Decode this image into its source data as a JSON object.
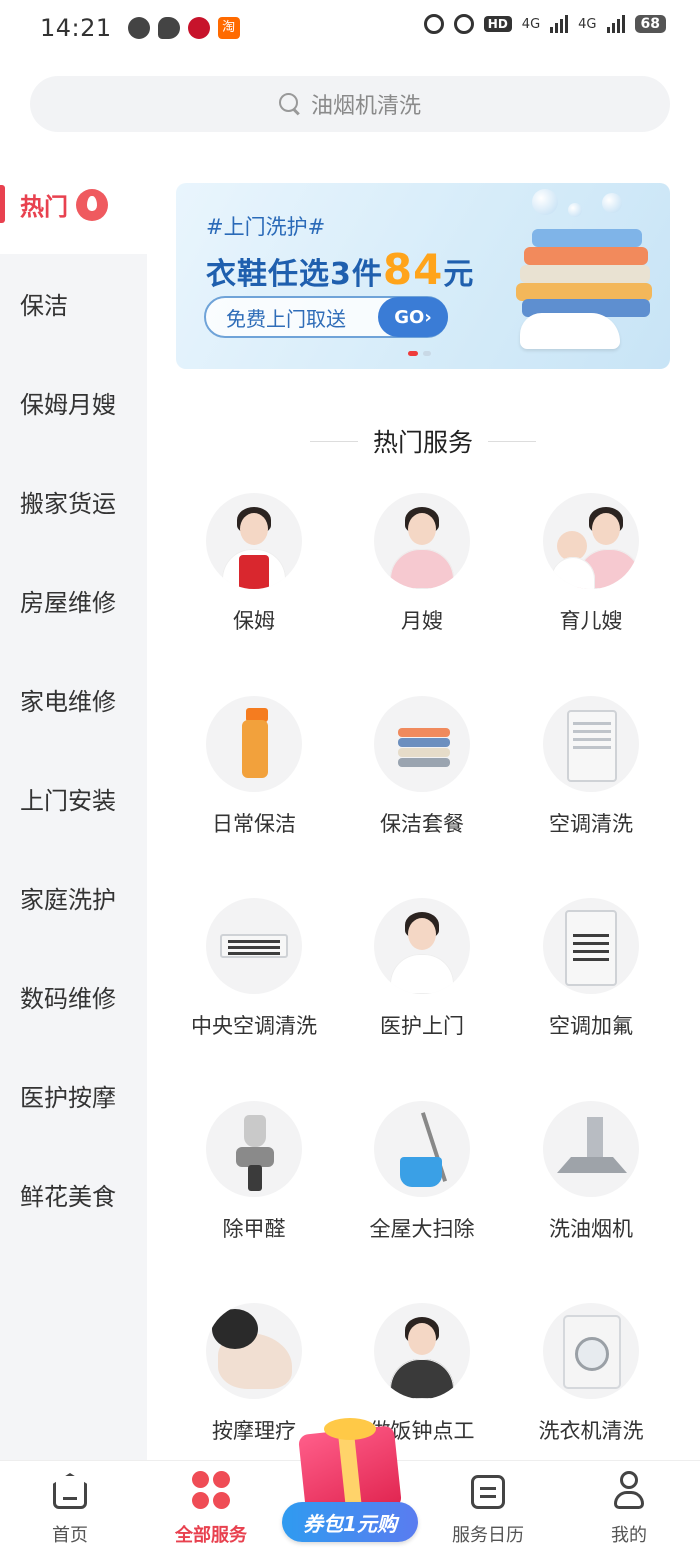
{
  "status_bar": {
    "time": "14:21",
    "network_1": "4G",
    "network_2": "4G",
    "hd": "HD",
    "battery": "68",
    "taobao_glyph": "淘"
  },
  "search": {
    "placeholder": "油烟机清洗"
  },
  "sidebar": {
    "items": [
      {
        "label": "热门",
        "active": true
      },
      {
        "label": "保洁"
      },
      {
        "label": "保姆月嫂"
      },
      {
        "label": "搬家货运"
      },
      {
        "label": "房屋维修"
      },
      {
        "label": "家电维修"
      },
      {
        "label": "上门安装"
      },
      {
        "label": "家庭洗护"
      },
      {
        "label": "数码维修"
      },
      {
        "label": "医护按摩"
      },
      {
        "label": "鲜花美食"
      }
    ]
  },
  "banner": {
    "tag": "#上门洗护#",
    "headline_prefix": "衣鞋任选3件",
    "price": "84",
    "price_unit": "元",
    "pill_text": "免费上门取送",
    "go_label": "GO›",
    "page_index": 1,
    "page_count": 2
  },
  "section": {
    "title": "热门服务"
  },
  "services": [
    {
      "label": "保姆",
      "icon": "nanny-icon"
    },
    {
      "label": "月嫂",
      "icon": "maternity-nurse-icon"
    },
    {
      "label": "育儿嫂",
      "icon": "childcare-icon"
    },
    {
      "label": "日常保洁",
      "icon": "cleaning-spray-icon"
    },
    {
      "label": "保洁套餐",
      "icon": "towel-stack-icon"
    },
    {
      "label": "空调清洗",
      "icon": "air-conditioner-icon"
    },
    {
      "label": "中央空调清洗",
      "icon": "central-ac-icon"
    },
    {
      "label": "医护上门",
      "icon": "nurse-icon"
    },
    {
      "label": "空调加氟",
      "icon": "ac-refrigerant-icon"
    },
    {
      "label": "除甲醛",
      "icon": "spray-gun-icon"
    },
    {
      "label": "全屋大扫除",
      "icon": "mop-bucket-icon"
    },
    {
      "label": "洗油烟机",
      "icon": "range-hood-icon"
    },
    {
      "label": "按摩理疗",
      "icon": "massage-icon"
    },
    {
      "label": "做饭钟点工",
      "icon": "cook-icon"
    },
    {
      "label": "洗衣机清洗",
      "icon": "washing-machine-icon"
    }
  ],
  "promo": {
    "label": "券包1元购"
  },
  "bottom_nav": [
    {
      "label": "首页",
      "icon": "home-icon"
    },
    {
      "label": "全部服务",
      "icon": "all-services-icon",
      "active": true
    },
    {
      "label": "服务日历",
      "icon": "calendar-icon"
    },
    {
      "label": "我的",
      "icon": "profile-icon"
    }
  ],
  "colors": {
    "accent": "#e8414f",
    "banner_blue": "#1f5fae",
    "banner_price": "#ffa41b"
  }
}
